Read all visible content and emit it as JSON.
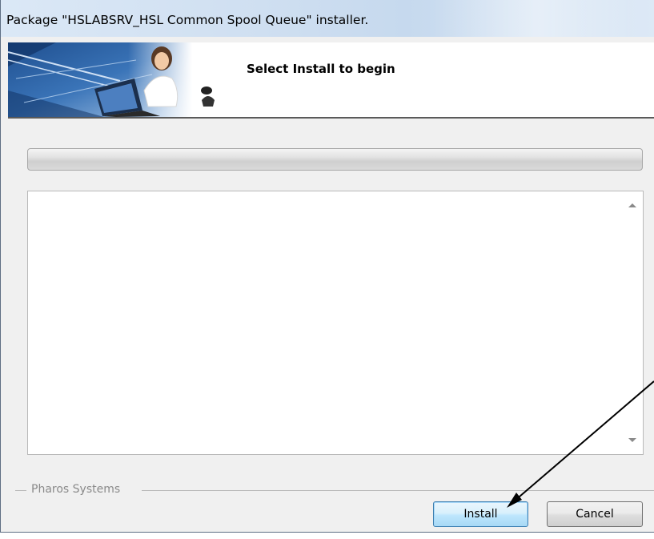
{
  "window": {
    "title": "Package \"HSLABSRV_HSL Common Spool Queue\" installer."
  },
  "banner": {
    "heading": "Select Install to begin"
  },
  "progress": {
    "value_percent": 0
  },
  "log": {
    "text": ""
  },
  "footer": {
    "group_label": "Pharos Systems"
  },
  "buttons": {
    "install_label": "Install",
    "cancel_label": "Cancel"
  },
  "colors": {
    "titlebar": "#cfdff1",
    "window_background": "#f0f0f0",
    "default_button_border": "#3c7fb1"
  },
  "icons": {
    "scroll_up": "scroll-up-arrow-icon",
    "scroll_down": "scroll-down-arrow-icon",
    "annotation": "pointer-arrow-icon"
  }
}
